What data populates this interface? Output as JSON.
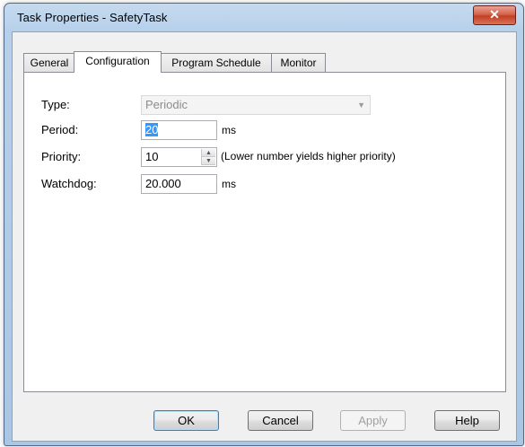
{
  "window": {
    "title": "Task Properties - SafetyTask",
    "close_icon": "close-x-icon"
  },
  "tabs": [
    {
      "label": "General",
      "active": false
    },
    {
      "label": "Configuration",
      "active": true
    },
    {
      "label": "Program Schedule",
      "active": false
    },
    {
      "label": "Monitor",
      "active": false
    }
  ],
  "form": {
    "type_label": "Type:",
    "type_value": "Periodic",
    "period_label": "Period:",
    "period_value": "20",
    "period_unit": "ms",
    "priority_label": "Priority:",
    "priority_value": "10",
    "priority_note": "(Lower number yields higher priority)",
    "watchdog_label": "Watchdog:",
    "watchdog_value": "20.000",
    "watchdog_unit": "ms"
  },
  "buttons": {
    "ok": "OK",
    "cancel": "Cancel",
    "apply": "Apply",
    "help": "Help"
  }
}
